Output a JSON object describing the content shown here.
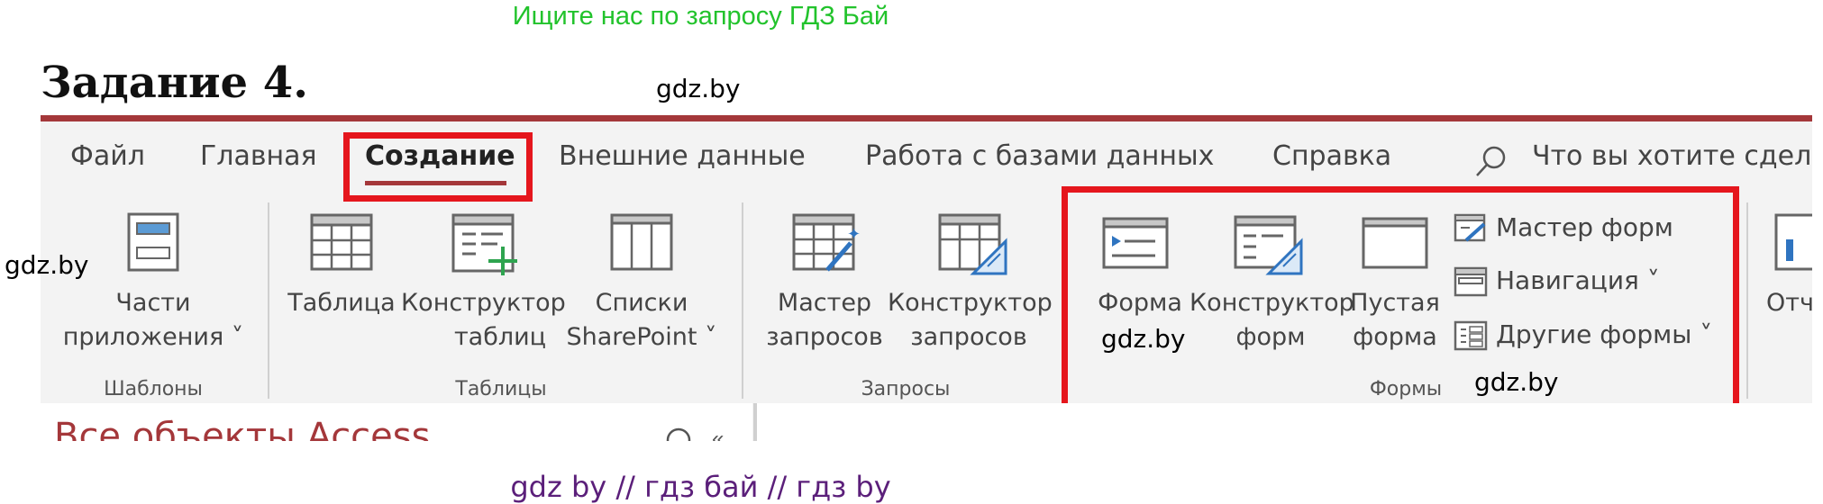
{
  "banner": "Ищите нас по запросу ГДЗ Бай",
  "task_title": "Задание 4.",
  "watermarks": {
    "w1": "gdz.by",
    "w2": "gdz.by",
    "w3": "gdz.by",
    "w4": "gdz.by"
  },
  "footer": "gdz by  //  гдз бай  //  гдз by",
  "ribbon": {
    "tabs": [
      "Файл",
      "Главная",
      "Создание",
      "Внешние данные",
      "Работа с базами данных",
      "Справка"
    ],
    "active_tab": "Создание",
    "search_placeholder": "Что вы хотите сдела",
    "groups": {
      "templates": {
        "label": "Шаблоны",
        "btn_app_parts_1": "Части",
        "btn_app_parts_2": "приложения ˅"
      },
      "tables": {
        "label": "Таблицы",
        "btn_table": "Таблица",
        "btn_table_designer_1": "Конструктор",
        "btn_table_designer_2": "таблиц",
        "btn_sharepoint_1": "Списки",
        "btn_sharepoint_2": "SharePoint ˅"
      },
      "queries": {
        "label": "Запросы",
        "btn_query_wizard_1": "Мастер",
        "btn_query_wizard_2": "запросов",
        "btn_query_designer_1": "Конструктор",
        "btn_query_designer_2": "запросов"
      },
      "forms": {
        "label": "Формы",
        "btn_form": "Форма",
        "btn_form_designer_1": "Конструктор",
        "btn_form_designer_2": "форм",
        "btn_blank_form_1": "Пустая",
        "btn_blank_form_2": "форма",
        "btn_form_wizard": "Мастер форм",
        "btn_navigation": "Навигация ˅",
        "btn_more_forms": "Другие формы ˅"
      },
      "reports": {
        "btn_report_partial": "Отч"
      }
    }
  },
  "nav_pane": {
    "title_partial": "Все объекты Access"
  },
  "colors": {
    "accent": "#a4373a",
    "highlight_red": "#e5161d",
    "banner_green": "#22c32c",
    "footer_purple": "#5b1f7a"
  }
}
